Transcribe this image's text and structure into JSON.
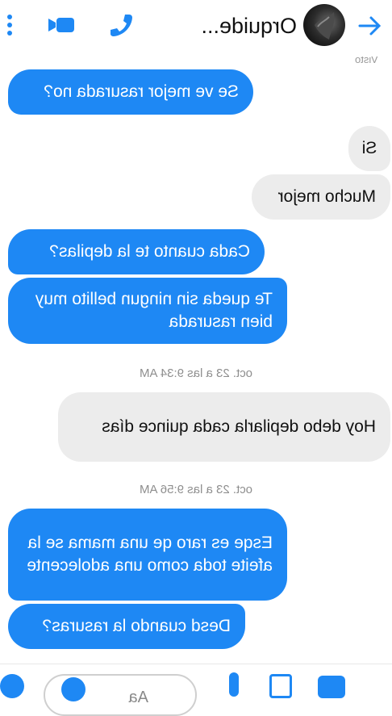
{
  "header": {
    "contact_name": "Orquide...",
    "icons": [
      "back-arrow-icon",
      "avatar",
      "phone-icon",
      "video-camera-icon",
      "more-icon"
    ]
  },
  "colors": {
    "accent": "#1e88f4",
    "incoming_bubble": "#ececec",
    "outgoing_bubble": "#1e88f4"
  },
  "chat": {
    "seen_label": "Visto",
    "messages": [
      {
        "side": "out",
        "text": "Se ve mejor rasurada no?"
      },
      {
        "side": "in",
        "text": "Si"
      },
      {
        "side": "in",
        "text": "Mucho mejor"
      },
      {
        "side": "out",
        "text": "Cada cuanto te la depilas?"
      },
      {
        "side": "out",
        "text": "Te queda sin ningun bellito muy bien rasurada"
      },
      {
        "side": "in",
        "text": "Hoy debo depilarla cada quince días"
      },
      {
        "side": "out",
        "text": "Esqe es raro qe una mama se la afeite toda como una adolecente"
      },
      {
        "side": "out",
        "text": "Desd cuando la rasuras?"
      }
    ],
    "timestamps": [
      "oct. 23 a las 9:34 AM",
      "oct. 23 a las 9:56 AM"
    ]
  },
  "composer": {
    "placeholder": "Aa",
    "icons": [
      "plus-icon",
      "camera-icon",
      "image-icon",
      "mic-icon",
      "emoji-icon"
    ]
  }
}
